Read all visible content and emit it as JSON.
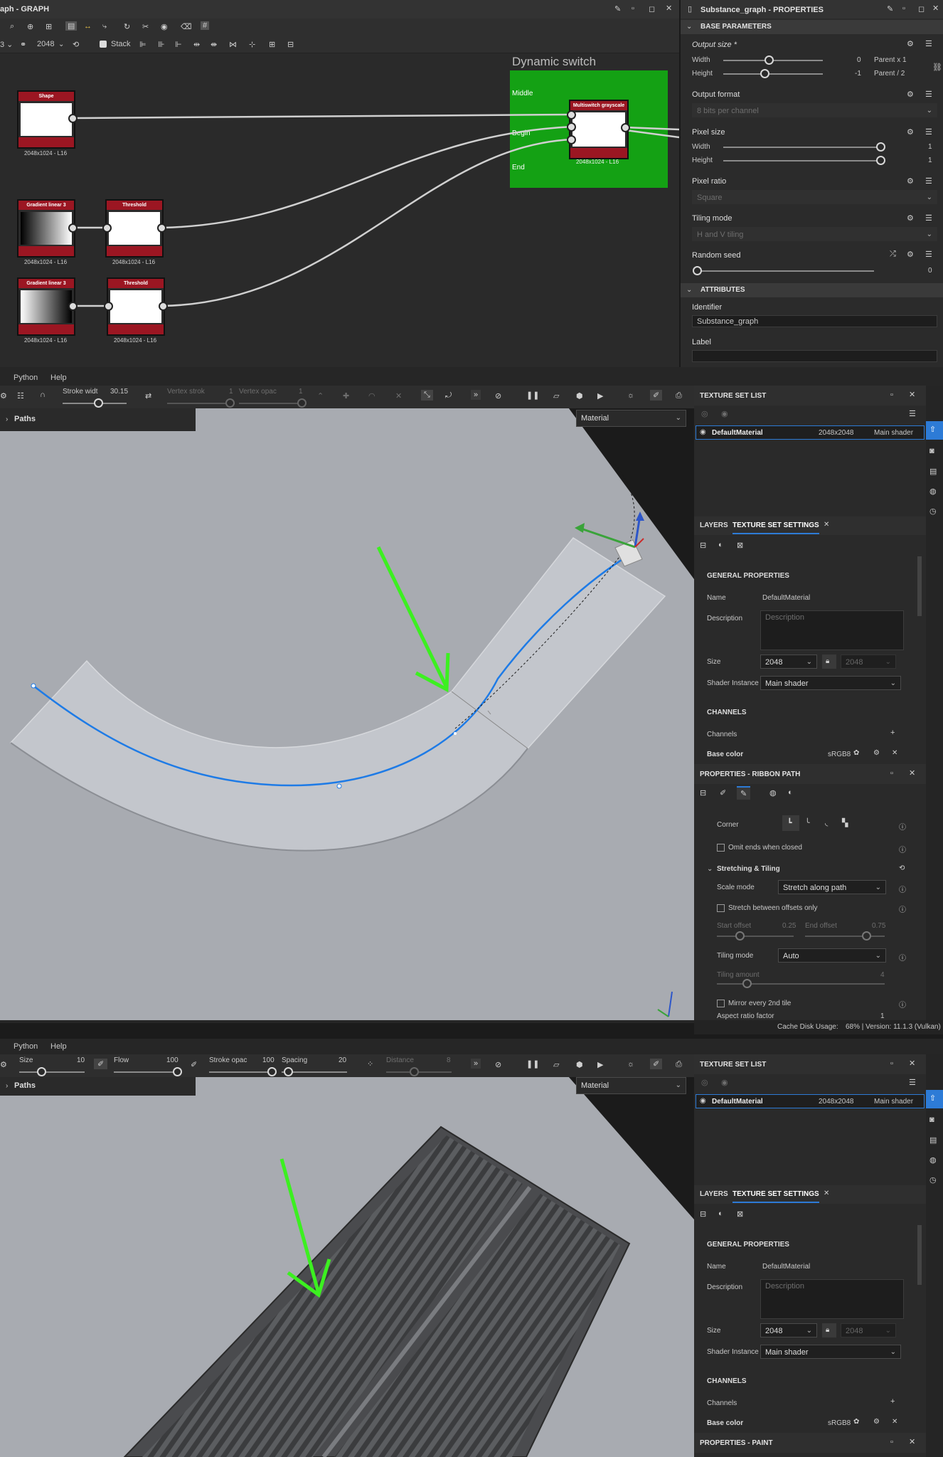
{
  "graph": {
    "title": "aph - GRAPH",
    "toolbar": {
      "size_value": "2048",
      "stack_label": "Stack"
    },
    "frame_title": "Dynamic switch",
    "frame_inputs": [
      "Middle",
      "Begin",
      "End"
    ],
    "nodes": [
      {
        "title": "Shape",
        "caption": "2048x1024 - L16"
      },
      {
        "title": "Gradient linear 3",
        "caption": "2048x1024 - L16"
      },
      {
        "title": "Threshold",
        "caption": "2048x1024 - L16"
      },
      {
        "title": "Gradient linear 3",
        "caption": "2048x1024 - L16"
      },
      {
        "title": "Threshold",
        "caption": "2048x1024 - L16"
      },
      {
        "title": "Multiswitch grayscale",
        "caption": "2048x1024 - L16"
      }
    ]
  },
  "properties": {
    "title": "Substance_graph - PROPERTIES",
    "base_parameters": "BASE PARAMETERS",
    "output_size": {
      "label": "Output size *",
      "width_label": "Width",
      "width_value": "0",
      "width_parent": "Parent x 1",
      "height_label": "Height",
      "height_value": "-1",
      "height_parent": "Parent / 2"
    },
    "output_format": {
      "label": "Output format",
      "value": "8 bits per channel"
    },
    "pixel_size": {
      "label": "Pixel size",
      "width_label": "Width",
      "width_value": "1",
      "height_label": "Height",
      "height_value": "1"
    },
    "pixel_ratio": {
      "label": "Pixel ratio",
      "value": "Square"
    },
    "tiling_mode": {
      "label": "Tiling mode",
      "value": "H and V tiling"
    },
    "random_seed": {
      "label": "Random seed",
      "value": "0"
    },
    "attributes": "ATTRIBUTES",
    "identifier": {
      "label": "Identifier",
      "value": "Substance_graph"
    },
    "label": {
      "label": "Label",
      "value": ""
    }
  },
  "painter1": {
    "menu": [
      "Python",
      "Help"
    ],
    "toolbar": {
      "stroke_width_label": "Stroke widt",
      "stroke_width_value": "30.15",
      "vertex_stroke_label": "Vertex strok",
      "vertex_stroke_value": "1",
      "vertex_opac_label": "Vertex opac",
      "vertex_opac_value": "1"
    },
    "paths_label": "Paths",
    "viewport_mode": "Material",
    "texture_set_list": {
      "title": "TEXTURE SET LIST",
      "item_name": "DefaultMaterial",
      "item_size": "2048x2048",
      "item_shader": "Main shader"
    },
    "tabs": {
      "layers": "LAYERS",
      "tss": "TEXTURE SET SETTINGS"
    },
    "general": {
      "header": "GENERAL PROPERTIES",
      "name_label": "Name",
      "name_value": "DefaultMaterial",
      "desc_label": "Description",
      "desc_placeholder": "Description",
      "size_label": "Size",
      "size_value": "2048",
      "size_locked": "2048",
      "shader_label": "Shader Instance",
      "shader_value": "Main shader"
    },
    "channels": {
      "header": "CHANNELS",
      "label": "Channels",
      "base_color": "Base color",
      "base_color_format": "sRGB8"
    },
    "ribbon": {
      "title": "PROPERTIES - RIBBON PATH",
      "corner_label": "Corner",
      "omit_ends": "Omit ends when closed",
      "stretch_header": "Stretching & Tiling",
      "scale_mode_label": "Scale mode",
      "scale_mode_value": "Stretch along path",
      "stretch_between": "Stretch between offsets only",
      "start_offset_label": "Start offset",
      "start_offset_value": "0.25",
      "end_offset_label": "End offset",
      "end_offset_value": "0.75",
      "tiling_mode_label": "Tiling mode",
      "tiling_mode_value": "Auto",
      "tiling_amount_label": "Tiling amount",
      "tiling_amount_value": "4",
      "mirror": "Mirror every 2nd tile",
      "aspect_label": "Aspect ratio factor",
      "aspect_value": "1"
    },
    "status": {
      "cache": "Cache Disk Usage:",
      "version": "68% | Version: 11.1.3 (Vulkan)"
    }
  },
  "painter2": {
    "menu": [
      "Python",
      "Help"
    ],
    "toolbar": {
      "size_label": "Size",
      "size_value": "10",
      "flow_label": "Flow",
      "flow_value": "100",
      "stroke_opac_label": "Stroke opac",
      "stroke_opac_value": "100",
      "spacing_label": "Spacing",
      "spacing_value": "20",
      "distance_label": "Distance",
      "distance_value": "8"
    },
    "paths_label": "Paths",
    "viewport_mode": "Material",
    "texture_set_list": {
      "title": "TEXTURE SET LIST",
      "item_name": "DefaultMaterial",
      "item_size": "2048x2048",
      "item_shader": "Main shader"
    },
    "tabs": {
      "layers": "LAYERS",
      "tss": "TEXTURE SET SETTINGS"
    },
    "general": {
      "header": "GENERAL PROPERTIES",
      "name_label": "Name",
      "name_value": "DefaultMaterial",
      "desc_label": "Description",
      "desc_placeholder": "Description",
      "size_label": "Size",
      "size_value": "2048",
      "size_locked": "2048",
      "shader_label": "Shader Instance",
      "shader_value": "Main shader"
    },
    "channels": {
      "header": "CHANNELS",
      "label": "Channels",
      "base_color": "Base color",
      "base_color_format": "sRGB8"
    },
    "paint_title": "PROPERTIES - PAINT"
  },
  "colors": {
    "frame_green": "#14a114",
    "node_red": "#9b1622",
    "accent_blue": "#2d7bd6",
    "arrow_green": "#3cf020",
    "path_blue": "#1e7be6"
  }
}
